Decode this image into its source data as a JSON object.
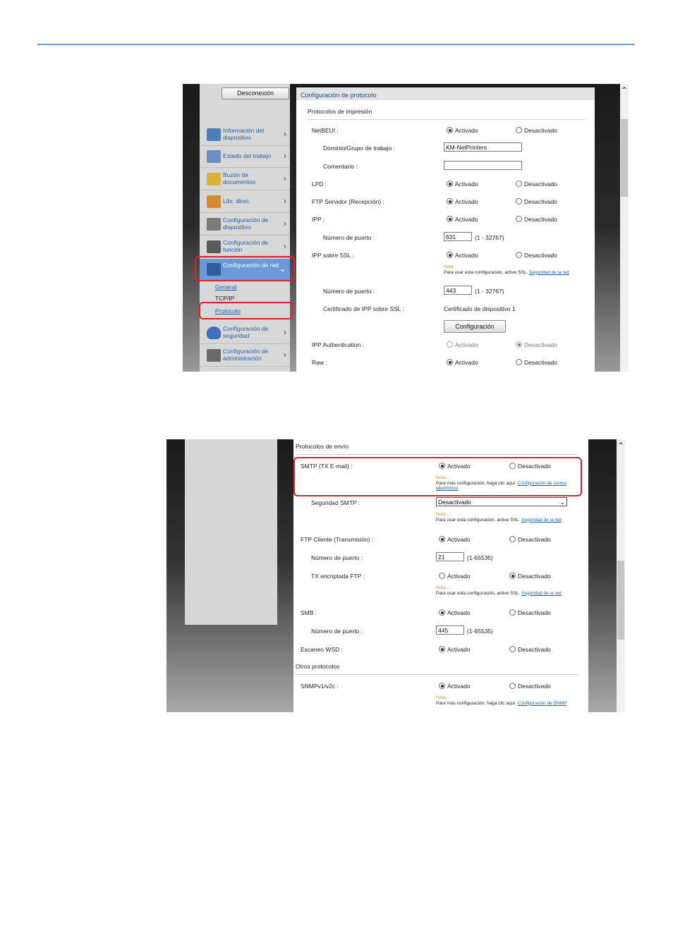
{
  "shot1": {
    "logout_label": "Desconexión",
    "header_title": "Configuración de protocolo",
    "section_title": "Protocolos de impresión",
    "nav": [
      {
        "label": "Información del dispositivo",
        "icon": "info-device-icon"
      },
      {
        "label": "Estado del trabajo",
        "icon": "job-status-icon"
      },
      {
        "label": "Buzón de documentos",
        "icon": "document-box-icon"
      },
      {
        "label": "Libr. direc.",
        "icon": "address-book-icon"
      },
      {
        "label": "Configuración de dispositivo",
        "icon": "device-settings-icon"
      },
      {
        "label": "Configuración de función",
        "icon": "function-settings-icon"
      },
      {
        "label": "Configuración de red",
        "icon": "network-settings-icon"
      },
      {
        "label": "Configuración de seguridad",
        "icon": "security-settings-icon"
      },
      {
        "label": "Configuración de administración",
        "icon": "admin-settings-icon"
      }
    ],
    "subnav": [
      "General",
      "TCP/IP",
      "Protocolo"
    ],
    "rows": {
      "netbeui": "NetBEUI :",
      "domain": "Dominio/Grupo de trabajo :",
      "domain_value": "KM-NetPrinters",
      "comment": "Comentario :",
      "lpd": "LPD :",
      "ftp_server": "FTP Servidor (Recepción) :",
      "ipp": "IPP :",
      "port": "Número de puerto :",
      "ipp_port": "631",
      "ipp_range": "(1 - 32767)",
      "ipp_ssl": "IPP sobre SSL :",
      "ssl_port": "443",
      "ssl_range": "(1 - 32767)",
      "cert": "Certificado de IPP sobre SSL :",
      "cert_value": "Certificado de dispositivo 1",
      "config_button": "Configuración",
      "ipp_auth": "IPP Authentication :",
      "raw": "Raw :"
    },
    "note": {
      "title": "Nota :",
      "text": "Para usar esta configuración, active SSL.",
      "link": "Seguridad de la red"
    }
  },
  "shot2": {
    "section_send": "Protocolos de envío",
    "smtp": "SMTP (TX E-mail) :",
    "smtp_note": {
      "title": "Nota :",
      "text": "Para más configuración, haga clic aquí.",
      "link": "Configuración de correo electrónico"
    },
    "smtp_security": "Seguridad SMTP :",
    "smtp_security_value": "Desactivado",
    "ssl_note": {
      "title": "Nota :",
      "text": "Para usar esta configuración, active SSL.",
      "link": "Seguridad de la red"
    },
    "ftp_client": "FTP Cliente (Transmisión) :",
    "port": "Número de puerto :",
    "ftp_port": "21",
    "ftp_range": "(1-65535)",
    "ftp_encrypted": "TX encriptada FTP :",
    "smb": "SMB :",
    "smb_port": "445",
    "smb_range": "(1-65535)",
    "wsd_scan": "Escaneo WSD :",
    "section_other": "Otros protocolos",
    "snmp": "SNMPv1/v2c :",
    "snmp_note": {
      "title": "Nota :",
      "text": "Para más configuración, haga clic aquí.",
      "link": "Configuración de SNMP"
    }
  },
  "radio": {
    "on": "Activado",
    "off": "Desactivado"
  },
  "colors": {
    "highlight": "#e0202a",
    "accent": "#1f5fa8",
    "top_rule": "#6fa1d6",
    "note_title": "#e08a16"
  }
}
